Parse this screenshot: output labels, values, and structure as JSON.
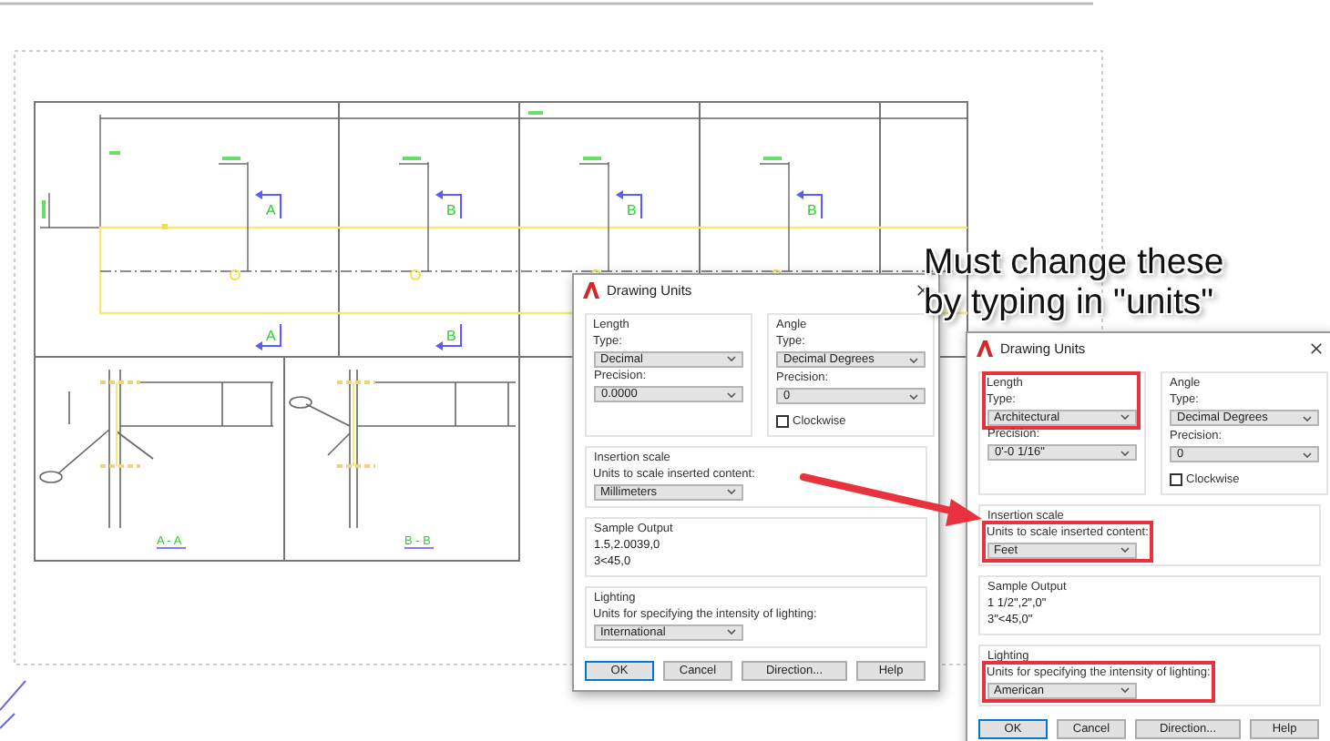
{
  "drawing": {
    "section_marks": [
      {
        "label": "A"
      },
      {
        "label": "B"
      },
      {
        "label": "B"
      },
      {
        "label": "B"
      },
      {
        "label": "A"
      },
      {
        "label": "B"
      }
    ],
    "section_titles": [
      "A - A",
      "B - B"
    ]
  },
  "callout": {
    "text": "Must change these by typing in \"units\""
  },
  "dialogs": [
    {
      "title": "Drawing Units",
      "length": {
        "label": "Length",
        "type_label": "Type:",
        "type_value": "Decimal",
        "precision_label": "Precision:",
        "precision_value": "0.0000",
        "highlighted": false
      },
      "angle": {
        "label": "Angle",
        "type_label": "Type:",
        "type_value": "Decimal Degrees",
        "precision_label": "Precision:",
        "precision_value": "0",
        "clockwise_label": "Clockwise",
        "clockwise": false
      },
      "insertion_scale": {
        "label": "Insertion scale",
        "hint": "Units to scale inserted content:",
        "value": "Millimeters",
        "highlighted": false
      },
      "sample_output": {
        "label": "Sample Output",
        "lines": [
          "1.5,2.0039,0",
          "3<45,0"
        ]
      },
      "lighting": {
        "label": "Lighting",
        "hint": "Units for specifying the intensity of lighting:",
        "value": "International",
        "highlighted": false
      },
      "buttons": [
        "OK",
        "Cancel",
        "Direction...",
        "Help"
      ]
    },
    {
      "title": "Drawing Units",
      "length": {
        "label": "Length",
        "type_label": "Type:",
        "type_value": "Architectural",
        "precision_label": "Precision:",
        "precision_value": "0'-0 1/16\"",
        "highlighted": true
      },
      "angle": {
        "label": "Angle",
        "type_label": "Type:",
        "type_value": "Decimal Degrees",
        "precision_label": "Precision:",
        "precision_value": "0",
        "clockwise_label": "Clockwise",
        "clockwise": false
      },
      "insertion_scale": {
        "label": "Insertion scale",
        "hint": "Units to scale inserted content:",
        "value": "Feet",
        "highlighted": true
      },
      "sample_output": {
        "label": "Sample Output",
        "lines": [
          "1 1/2\",2\",0\"",
          "3\"<45,0\""
        ]
      },
      "lighting": {
        "label": "Lighting",
        "hint": "Units for specifying the intensity of lighting:",
        "value": "American",
        "highlighted": true
      },
      "buttons": [
        "OK",
        "Cancel",
        "Direction...",
        "Help"
      ]
    }
  ]
}
